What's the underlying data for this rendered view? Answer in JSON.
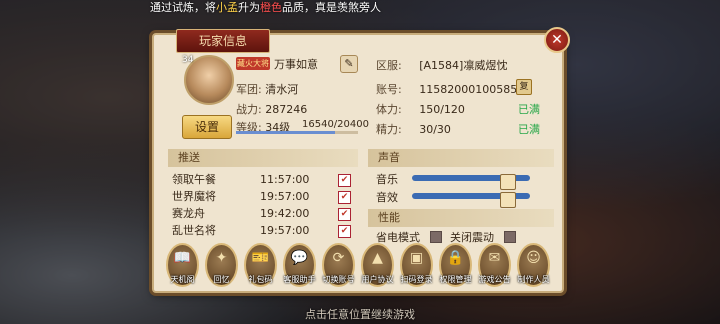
{
  "ticker": {
    "prefix": "通过试炼，将",
    "item": "小孟",
    "mid": "升为",
    "quality": "橙色",
    "suffix": "品质，真是羡煞旁人"
  },
  "footer_hint": "点击任意位置继续游戏",
  "panel": {
    "title": "玩家信息"
  },
  "player": {
    "level_badge": "34",
    "vip_tag": "藏火大将",
    "name": "万事如意",
    "legion_label": "军团:",
    "legion": "清水河",
    "power_label": "战力:",
    "power": "287246",
    "level_label": "等级:",
    "level": "34级",
    "exp_text": "16540/20400",
    "exp_fraction": 0.81
  },
  "server": {
    "zone_label": "区服:",
    "zone": "[A1584]凛威煜忱",
    "account_label": "账号:",
    "account": "115820001005851",
    "stamina_label": "体力:",
    "stamina": "150/120",
    "stamina_status": "已满",
    "energy_label": "精力:",
    "energy": "30/30",
    "energy_status": "已满"
  },
  "buttons": {
    "settings": "设置",
    "copy": "复",
    "edit": "✎",
    "close": "✕"
  },
  "push": {
    "heading": "推送",
    "items": [
      {
        "name": "领取午餐",
        "time": "11:57:00",
        "checked": true
      },
      {
        "name": "世界魔将",
        "time": "19:57:00",
        "checked": true
      },
      {
        "name": "赛龙舟",
        "time": "19:42:00",
        "checked": true
      },
      {
        "name": "乱世名将",
        "time": "19:57:00",
        "checked": true
      }
    ]
  },
  "sound": {
    "heading": "声音",
    "music_label": "音乐",
    "music_level": 0.85,
    "effect_label": "音效",
    "effect_level": 0.85
  },
  "performance": {
    "heading": "性能",
    "power_save_label": "省电模式",
    "vibration_label": "关闭震动"
  },
  "bottom_buttons": [
    {
      "label": "天机阁",
      "icon": "book-icon",
      "glyph": "📖"
    },
    {
      "label": "回忆",
      "icon": "leaf-icon",
      "glyph": "✦"
    },
    {
      "label": "礼包码",
      "icon": "ticket-icon",
      "glyph": "🎫"
    },
    {
      "label": "客服助手",
      "icon": "chat-icon",
      "glyph": "💬"
    },
    {
      "label": "切换账号",
      "icon": "switch-icon",
      "glyph": "⟳"
    },
    {
      "label": "用户协议",
      "icon": "up-icon",
      "glyph": "▲"
    },
    {
      "label": "扫码登录",
      "icon": "scan-icon",
      "glyph": "▣"
    },
    {
      "label": "权限管理",
      "icon": "lock-icon",
      "glyph": "🔒"
    },
    {
      "label": "游戏公告",
      "icon": "notice-icon",
      "glyph": "✉"
    },
    {
      "label": "制作人员",
      "icon": "person-icon",
      "glyph": "☺"
    }
  ],
  "colors": {
    "full_status": "#2aa84a",
    "exp_bar": "#6a8ed1",
    "slider": "#3b6bb3",
    "title_bg": "#8f2a1e"
  }
}
